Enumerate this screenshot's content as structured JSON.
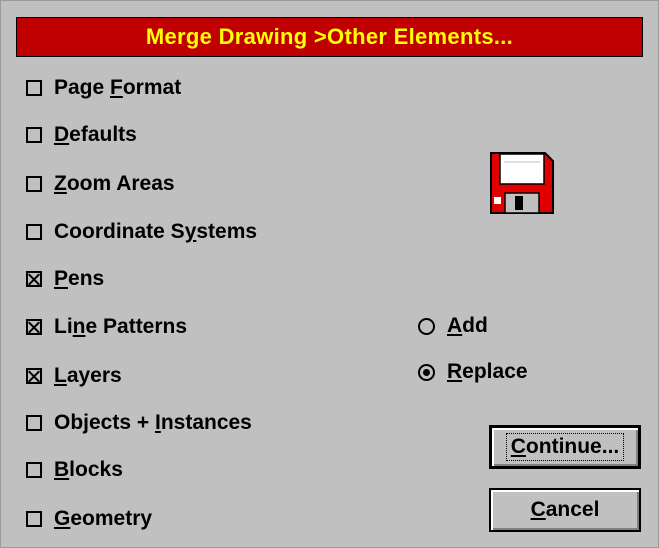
{
  "dialog": {
    "title": "Merge Drawing >Other Elements...",
    "colors": {
      "titlebar_bg": "#c00000",
      "title_text": "#ffff00",
      "face": "#c0c0c0"
    }
  },
  "options": [
    {
      "before": "Page ",
      "mnemonic": "F",
      "after": "ormat",
      "checked": false
    },
    {
      "before": "",
      "mnemonic": "D",
      "after": "efaults",
      "checked": false
    },
    {
      "before": "",
      "mnemonic": "Z",
      "after": "oom Areas",
      "checked": false
    },
    {
      "before": "Coordinate S",
      "mnemonic": "y",
      "after": "stems",
      "checked": false
    },
    {
      "before": "",
      "mnemonic": "P",
      "after": "ens",
      "checked": true
    },
    {
      "before": "Li",
      "mnemonic": "n",
      "after": "e Patterns",
      "checked": true
    },
    {
      "before": "",
      "mnemonic": "L",
      "after": "ayers",
      "checked": true
    },
    {
      "before": "Objects + ",
      "mnemonic": "I",
      "after": "nstances",
      "checked": false
    },
    {
      "before": "",
      "mnemonic": "B",
      "after": "locks",
      "checked": false
    },
    {
      "before": "",
      "mnemonic": "G",
      "after": "eometry",
      "checked": false
    }
  ],
  "mode": {
    "add": {
      "mnemonic": "A",
      "after": "dd",
      "selected": false
    },
    "replace": {
      "mnemonic": "R",
      "after": "eplace",
      "selected": true
    }
  },
  "buttons": {
    "continue": {
      "mnemonic": "C",
      "after": "ontinue..."
    },
    "cancel": {
      "mnemonic": "C",
      "after": "ancel"
    }
  },
  "icons": {
    "save": "floppy-disk-icon"
  }
}
